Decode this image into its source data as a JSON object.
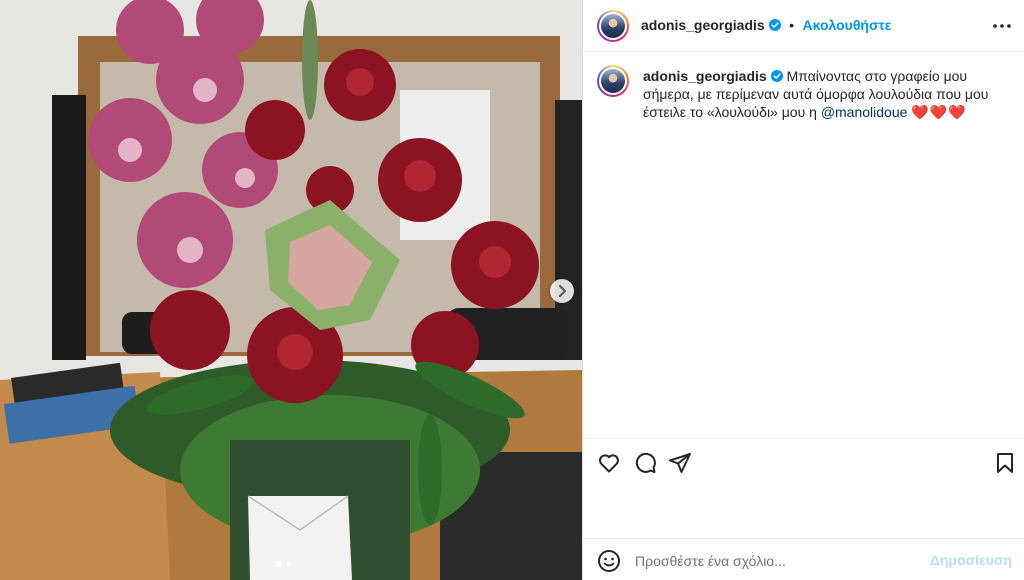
{
  "post": {
    "image_alt": "",
    "carousel": {
      "count": 2,
      "active": 0
    }
  },
  "header": {
    "username": "adonis_georgiadis",
    "separator": "•",
    "follow_label": "Ακολουθήστε"
  },
  "caption": {
    "username": "adonis_georgiadis",
    "text": "Μπαίνοντας στο γραφείο μου σήμερα, με περίμεναν αυτά όμορφα λουλούδια που μου έστειλε το «λουλούδι» μου η ",
    "mention": "@manolidoue",
    "emoji": "❤️❤️❤️"
  },
  "comment": {
    "placeholder": "Προσθέστε ένα σχόλιο...",
    "post_label": "Δημοσίευση"
  },
  "icons": [
    "verified-badge-icon",
    "more-options-icon",
    "like-icon",
    "comment-icon",
    "share-icon",
    "save-icon",
    "emoji-icon",
    "next-arrow-icon"
  ],
  "colors": {
    "accent": "#0095f6",
    "mention": "#00376b",
    "post_disabled": "#b2dffc"
  }
}
